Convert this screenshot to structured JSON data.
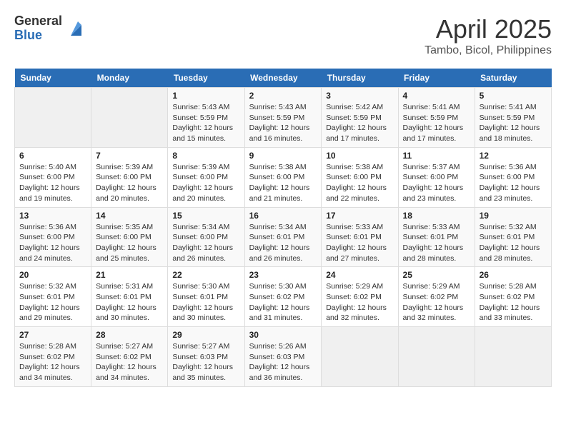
{
  "header": {
    "logo_general": "General",
    "logo_blue": "Blue",
    "month_year": "April 2025",
    "location": "Tambo, Bicol, Philippines"
  },
  "weekdays": [
    "Sunday",
    "Monday",
    "Tuesday",
    "Wednesday",
    "Thursday",
    "Friday",
    "Saturday"
  ],
  "weeks": [
    [
      null,
      null,
      {
        "day": 1,
        "sunrise": "5:43 AM",
        "sunset": "5:59 PM",
        "daylight": "12 hours and 15 minutes."
      },
      {
        "day": 2,
        "sunrise": "5:43 AM",
        "sunset": "5:59 PM",
        "daylight": "12 hours and 16 minutes."
      },
      {
        "day": 3,
        "sunrise": "5:42 AM",
        "sunset": "5:59 PM",
        "daylight": "12 hours and 17 minutes."
      },
      {
        "day": 4,
        "sunrise": "5:41 AM",
        "sunset": "5:59 PM",
        "daylight": "12 hours and 17 minutes."
      },
      {
        "day": 5,
        "sunrise": "5:41 AM",
        "sunset": "5:59 PM",
        "daylight": "12 hours and 18 minutes."
      }
    ],
    [
      {
        "day": 6,
        "sunrise": "5:40 AM",
        "sunset": "6:00 PM",
        "daylight": "12 hours and 19 minutes."
      },
      {
        "day": 7,
        "sunrise": "5:39 AM",
        "sunset": "6:00 PM",
        "daylight": "12 hours and 20 minutes."
      },
      {
        "day": 8,
        "sunrise": "5:39 AM",
        "sunset": "6:00 PM",
        "daylight": "12 hours and 20 minutes."
      },
      {
        "day": 9,
        "sunrise": "5:38 AM",
        "sunset": "6:00 PM",
        "daylight": "12 hours and 21 minutes."
      },
      {
        "day": 10,
        "sunrise": "5:38 AM",
        "sunset": "6:00 PM",
        "daylight": "12 hours and 22 minutes."
      },
      {
        "day": 11,
        "sunrise": "5:37 AM",
        "sunset": "6:00 PM",
        "daylight": "12 hours and 23 minutes."
      },
      {
        "day": 12,
        "sunrise": "5:36 AM",
        "sunset": "6:00 PM",
        "daylight": "12 hours and 23 minutes."
      }
    ],
    [
      {
        "day": 13,
        "sunrise": "5:36 AM",
        "sunset": "6:00 PM",
        "daylight": "12 hours and 24 minutes."
      },
      {
        "day": 14,
        "sunrise": "5:35 AM",
        "sunset": "6:00 PM",
        "daylight": "12 hours and 25 minutes."
      },
      {
        "day": 15,
        "sunrise": "5:34 AM",
        "sunset": "6:00 PM",
        "daylight": "12 hours and 26 minutes."
      },
      {
        "day": 16,
        "sunrise": "5:34 AM",
        "sunset": "6:01 PM",
        "daylight": "12 hours and 26 minutes."
      },
      {
        "day": 17,
        "sunrise": "5:33 AM",
        "sunset": "6:01 PM",
        "daylight": "12 hours and 27 minutes."
      },
      {
        "day": 18,
        "sunrise": "5:33 AM",
        "sunset": "6:01 PM",
        "daylight": "12 hours and 28 minutes."
      },
      {
        "day": 19,
        "sunrise": "5:32 AM",
        "sunset": "6:01 PM",
        "daylight": "12 hours and 28 minutes."
      }
    ],
    [
      {
        "day": 20,
        "sunrise": "5:32 AM",
        "sunset": "6:01 PM",
        "daylight": "12 hours and 29 minutes."
      },
      {
        "day": 21,
        "sunrise": "5:31 AM",
        "sunset": "6:01 PM",
        "daylight": "12 hours and 30 minutes."
      },
      {
        "day": 22,
        "sunrise": "5:30 AM",
        "sunset": "6:01 PM",
        "daylight": "12 hours and 30 minutes."
      },
      {
        "day": 23,
        "sunrise": "5:30 AM",
        "sunset": "6:02 PM",
        "daylight": "12 hours and 31 minutes."
      },
      {
        "day": 24,
        "sunrise": "5:29 AM",
        "sunset": "6:02 PM",
        "daylight": "12 hours and 32 minutes."
      },
      {
        "day": 25,
        "sunrise": "5:29 AM",
        "sunset": "6:02 PM",
        "daylight": "12 hours and 32 minutes."
      },
      {
        "day": 26,
        "sunrise": "5:28 AM",
        "sunset": "6:02 PM",
        "daylight": "12 hours and 33 minutes."
      }
    ],
    [
      {
        "day": 27,
        "sunrise": "5:28 AM",
        "sunset": "6:02 PM",
        "daylight": "12 hours and 34 minutes."
      },
      {
        "day": 28,
        "sunrise": "5:27 AM",
        "sunset": "6:02 PM",
        "daylight": "12 hours and 34 minutes."
      },
      {
        "day": 29,
        "sunrise": "5:27 AM",
        "sunset": "6:03 PM",
        "daylight": "12 hours and 35 minutes."
      },
      {
        "day": 30,
        "sunrise": "5:26 AM",
        "sunset": "6:03 PM",
        "daylight": "12 hours and 36 minutes."
      },
      null,
      null,
      null
    ]
  ]
}
